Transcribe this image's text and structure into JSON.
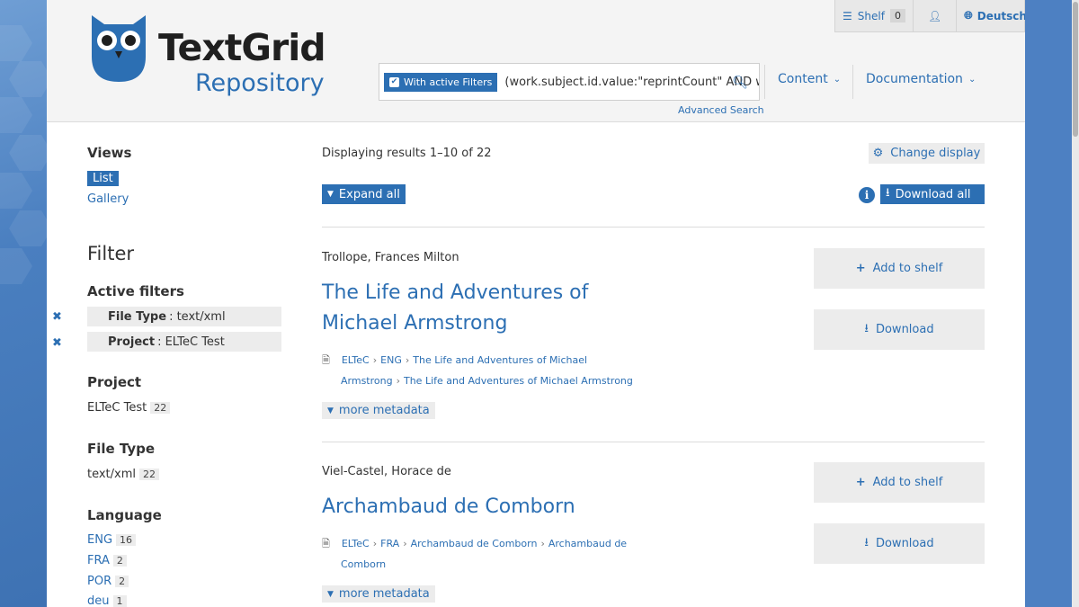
{
  "header": {
    "logo_title": "TextGrid",
    "logo_subtitle": "Repository",
    "topbar": {
      "shelf_label": "Shelf",
      "shelf_count": "0",
      "language": "Deutsch"
    },
    "search": {
      "filter_chip": "With active Filters",
      "query": "(work.subject.id.value:\"reprintCount\" AND w",
      "advanced": "Advanced Search"
    },
    "nav": {
      "content": "Content",
      "documentation": "Documentation"
    }
  },
  "sidebar": {
    "views_heading": "Views",
    "views": [
      "List",
      "Gallery"
    ],
    "filter_heading": "Filter",
    "active_heading": "Active filters",
    "active_filters": [
      {
        "key": "File Type",
        "value": "text/xml"
      },
      {
        "key": "Project",
        "value": "ELTeC Test"
      }
    ],
    "project_heading": "Project",
    "project": {
      "label": "ELTeC Test",
      "count": "22"
    },
    "filetype_heading": "File Type",
    "filetype": {
      "label": "text/xml",
      "count": "22"
    },
    "language_heading": "Language",
    "languages": [
      {
        "label": "ENG",
        "count": "16"
      },
      {
        "label": "FRA",
        "count": "2"
      },
      {
        "label": "POR",
        "count": "2"
      },
      {
        "label": "deu",
        "count": "1"
      }
    ]
  },
  "main": {
    "displaying": "Displaying results 1–10 of 22",
    "change_display": "Change display",
    "expand_all": "Expand all",
    "download_all": "Download all",
    "results": [
      {
        "author": "Trollope, Frances Milton",
        "title_line1": "The Life and Adventures of",
        "title_line2": "Michael Armstrong",
        "crumbs": [
          "ELTeC",
          "ENG",
          "The Life and Adventures of Michael",
          "Armstrong",
          "The Life and Adventures of Michael Armstrong"
        ],
        "more": "more metadata",
        "add": "Add to shelf",
        "download": "Download"
      },
      {
        "author": "Viel-Castel, Horace de",
        "title_line1": "Archambaud de Comborn",
        "crumbs": [
          "ELTeC",
          "FRA",
          "Archambaud de Comborn",
          "Archambaud de",
          "Comborn"
        ],
        "more": "more metadata",
        "add": "Add to shelf",
        "download": "Download"
      }
    ]
  },
  "colors": {
    "accent": "#2c6fb3",
    "header_bg": "#f4f4f4",
    "chip_bg": "#ececec"
  }
}
